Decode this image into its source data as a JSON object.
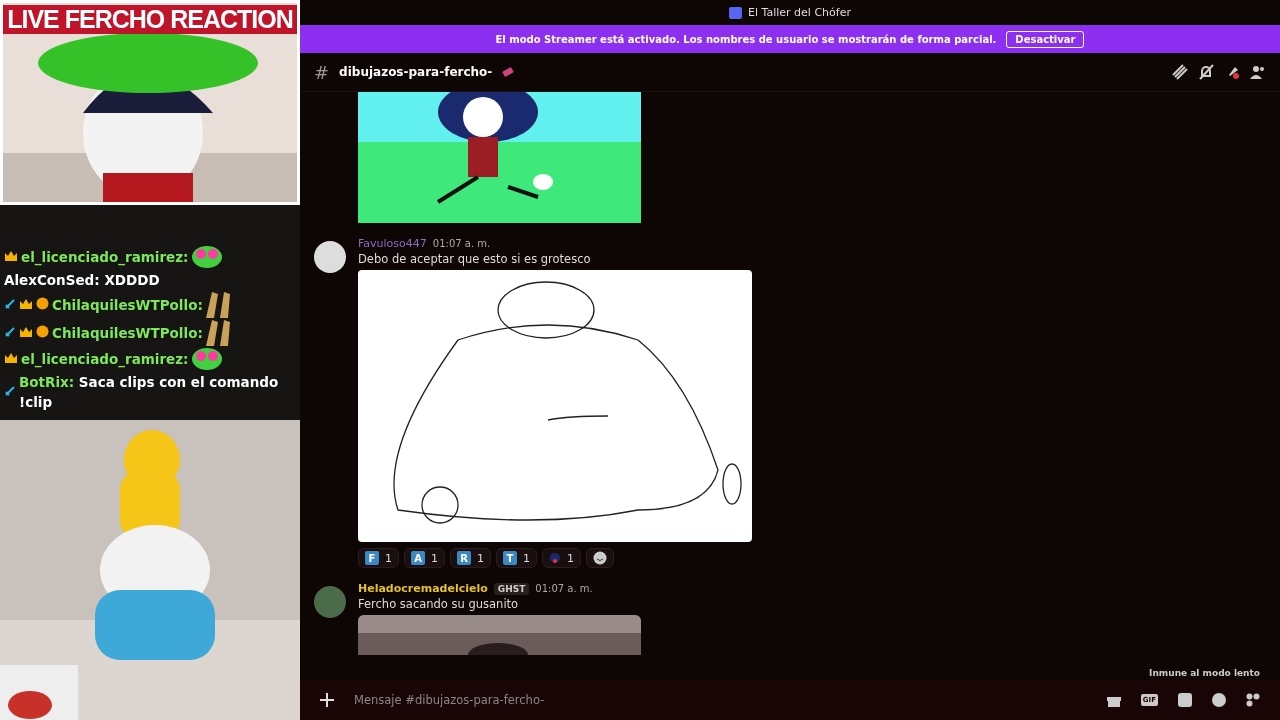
{
  "stream": {
    "title": "LIVE FERCHO REACTION"
  },
  "stream_chat": [
    {
      "kind": "heart",
      "sword": false,
      "crown": true,
      "coin": false,
      "user": "el_licenciado_ramirez:",
      "color": "#7ee85a"
    },
    {
      "kind": "text",
      "sword": false,
      "crown": false,
      "coin": false,
      "user": "AlexConSed:",
      "color": "#ffffff",
      "text": "XDDDD"
    },
    {
      "kind": "clap",
      "sword": true,
      "crown": true,
      "coin": true,
      "user": "ChilaquilesWTPollo:",
      "color": "#7ee85a"
    },
    {
      "kind": "clap",
      "sword": true,
      "crown": true,
      "coin": true,
      "user": "ChilaquilesWTPollo:",
      "color": "#7ee85a"
    },
    {
      "kind": "heart",
      "sword": false,
      "crown": true,
      "coin": false,
      "user": "el_licenciado_ramirez:",
      "color": "#7ee85a"
    },
    {
      "kind": "text",
      "sword": true,
      "crown": false,
      "coin": false,
      "user": "BotRix:",
      "color": "#7ee85a",
      "text": "Saca clips con el comando !clip"
    }
  ],
  "window": {
    "title": "El Taller del Chófer"
  },
  "banner": {
    "text": "El modo Streamer está activado. Los nombres de usuario se mostrarán de forma parcial.",
    "button": "Desactivar"
  },
  "channel": {
    "prefix": "#",
    "name": "dibujazos-para-fercho-"
  },
  "messages": [
    {
      "author": "Favuloso447",
      "color": "#8e6bbf",
      "time": "01:07 a. m.",
      "text": "Debo de aceptar que esto si es grotesco",
      "reactions": [
        {
          "label": "F",
          "count": "1"
        },
        {
          "label": "A",
          "count": "1"
        },
        {
          "label": "R",
          "count": "1"
        },
        {
          "label": "T",
          "count": "1"
        },
        {
          "count": "1"
        }
      ]
    },
    {
      "author": "Heladocremadelcielo",
      "color": "#e5c12a",
      "tag": "GHST",
      "time": "01:07 a. m.",
      "text": "Fercho sacando su gusanito"
    }
  ],
  "slowmode": "Inmune al modo lento",
  "composer": {
    "placeholder": "Mensaje #dibujazos-para-fercho-",
    "gif_label": "GIF"
  }
}
